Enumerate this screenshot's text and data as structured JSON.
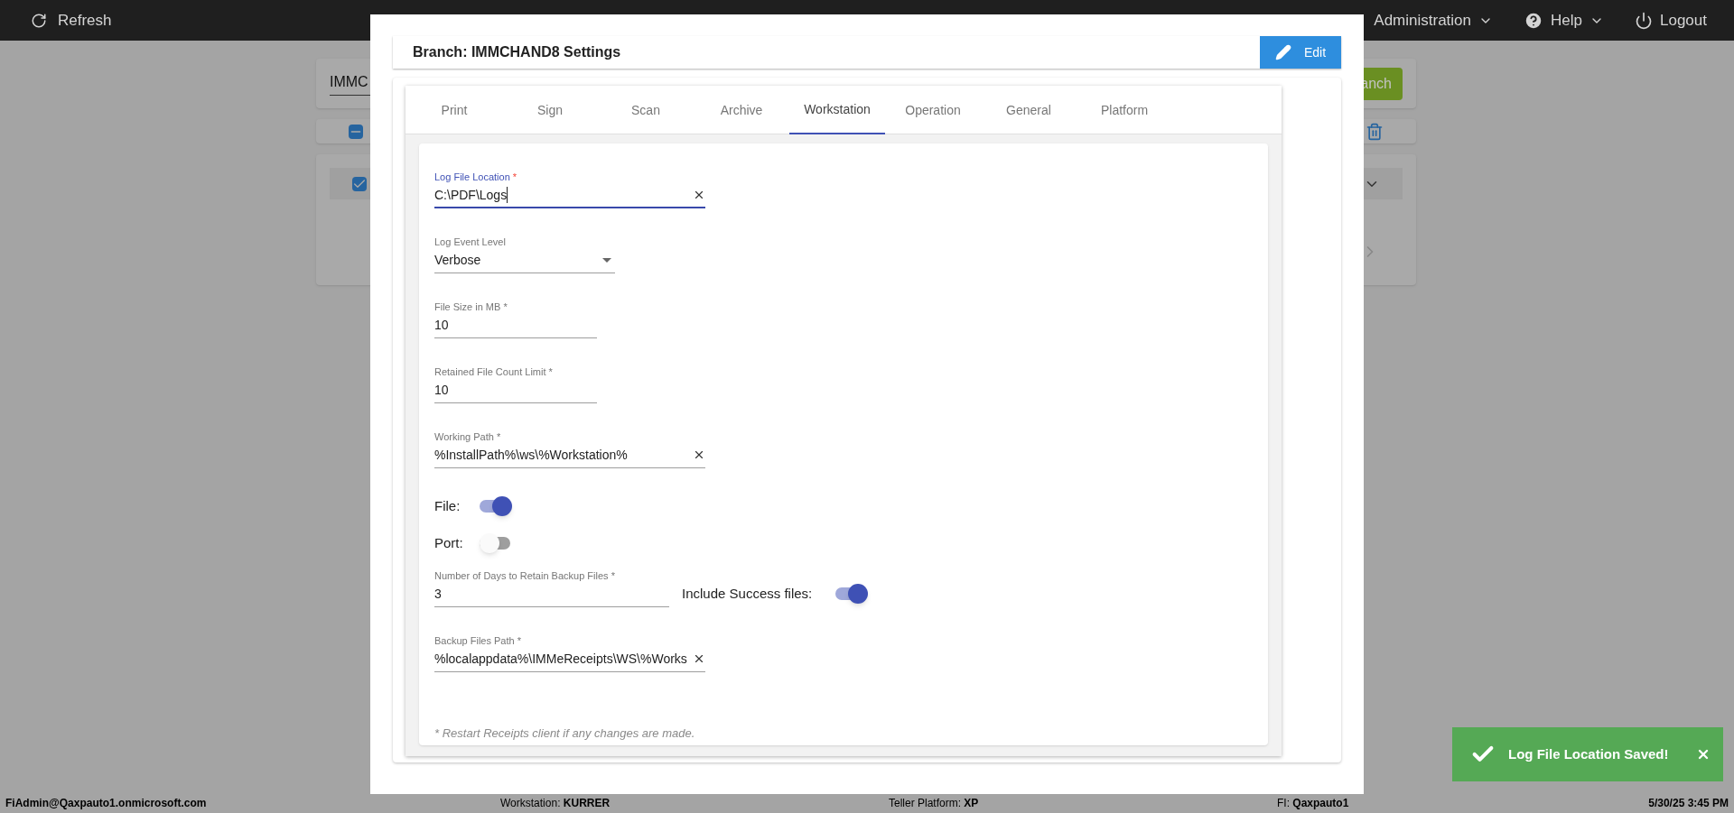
{
  "top_bar": {
    "refresh": "Refresh",
    "menus": [
      {
        "label": "Administration",
        "kind": "dropdown"
      },
      {
        "label": "Help",
        "kind": "dropdown"
      },
      {
        "label": "Logout",
        "kind": "logout"
      }
    ]
  },
  "background": {
    "search_value": "IMMC",
    "search_button": "anch"
  },
  "modal": {
    "title": "Branch: IMMCHAND8 Settings",
    "edit_button": "Edit",
    "tabs": [
      {
        "label": "Print",
        "selected": false
      },
      {
        "label": "Sign",
        "selected": false
      },
      {
        "label": "Scan",
        "selected": false
      },
      {
        "label": "Archive",
        "selected": false
      },
      {
        "label": "Workstation",
        "selected": true
      },
      {
        "label": "Operation",
        "selected": false
      },
      {
        "label": "General",
        "selected": false
      },
      {
        "label": "Platform",
        "selected": false
      }
    ],
    "fields": [
      {
        "kind": "path",
        "label": "Log File Location",
        "asterisk": "*",
        "value": "C:\\PDF\\Logs",
        "focused": true
      },
      {
        "kind": "select",
        "label": "Log Event Level",
        "value": "Verbose",
        "focused": false
      },
      {
        "kind": "number",
        "label": "File Size in MB",
        "asterisk": "*",
        "value": "10",
        "focused": false
      },
      {
        "kind": "number",
        "label": "Retained File Count Limit",
        "asterisk": "*",
        "value": "10",
        "focused": false
      },
      {
        "kind": "path",
        "label": "Working Path",
        "asterisk": "*",
        "value": "%InstallPath%\\ws\\%Workstation%",
        "focused": false
      },
      {
        "kind": "toggle",
        "label": "File:",
        "on": true
      },
      {
        "kind": "toggle",
        "label": "Port:",
        "on": false
      },
      {
        "kind": "number-with-toggle",
        "label": "Number of Days to Retain Backup Files",
        "asterisk": "*",
        "value": "3",
        "focused": false,
        "toggle": {
          "label": "Include Success files:",
          "on": true
        }
      },
      {
        "kind": "path",
        "label": "Backup Files Path",
        "asterisk": "*",
        "value": "%localappdata%\\IMMeReceipts\\WS\\%Works",
        "focused": false
      }
    ],
    "note": "* Restart Receipts client if any changes are made."
  },
  "status_bar": {
    "user": "FiAdmin@Qaxpauto1.onmicrosoft.com",
    "items": [
      "Workstation: **KURRER**",
      "Teller Platform: **XP**",
      "FI: **Qaxpauto1**"
    ],
    "datetime": "5/30/25 3:45 PM"
  },
  "toast": {
    "message": "Log File Location Saved!"
  }
}
